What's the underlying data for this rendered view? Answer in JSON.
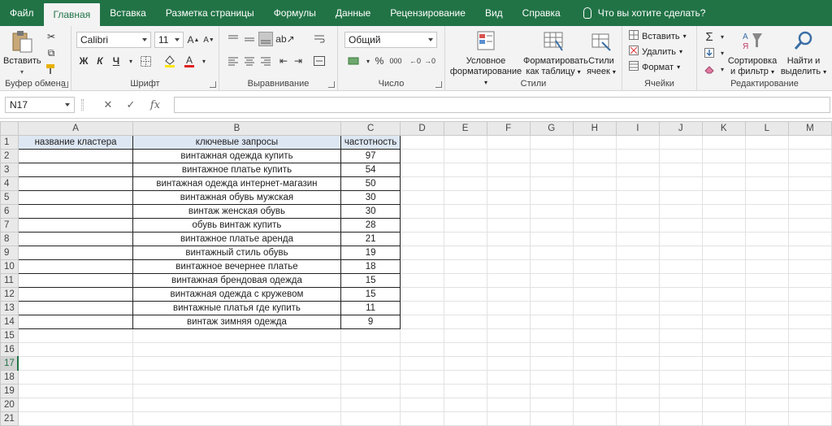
{
  "tabs": [
    "Файл",
    "Главная",
    "Вставка",
    "Разметка страницы",
    "Формулы",
    "Данные",
    "Рецензирование",
    "Вид",
    "Справка"
  ],
  "active_tab": 1,
  "tell_me": "Что вы хотите сделать?",
  "ribbon": {
    "clipboard": {
      "paste": "Вставить",
      "label": "Буфер обмена"
    },
    "font": {
      "name": "Calibri",
      "size": "11",
      "bold": "Ж",
      "italic": "К",
      "underline": "Ч",
      "grow": "A",
      "shrink": "A",
      "fontcolor": "A",
      "label": "Шрифт",
      "font_color": "#e02020",
      "highlight_color": "#ffe600"
    },
    "alignment": {
      "label": "Выравнивание"
    },
    "number": {
      "format": "Общий",
      "percent": "%",
      "thousands": "000",
      "label": "Число"
    },
    "styles": {
      "conditional": [
        "Условное",
        "форматирование"
      ],
      "as_table": [
        "Форматировать",
        "как таблицу"
      ],
      "cell_styles": [
        "Стили",
        "ячеек"
      ],
      "label": "Стили"
    },
    "cells": {
      "insert": "Вставить",
      "delete": "Удалить",
      "format": "Формат",
      "label": "Ячейки"
    },
    "editing": {
      "sort": [
        "Сортировка",
        "и фильтр"
      ],
      "find": [
        "Найти и",
        "выделить"
      ],
      "label": "Редактирование"
    }
  },
  "formula_bar": {
    "name_box": "N17",
    "fx": "fx",
    "value": ""
  },
  "columns": [
    "A",
    "B",
    "C",
    "D",
    "E",
    "F",
    "G",
    "H",
    "I",
    "J",
    "K",
    "L",
    "M"
  ],
  "selected_row": 17,
  "rows": [
    [
      "название кластера",
      "ключевые запросы",
      "частотность"
    ],
    [
      "",
      "винтажная одежда купить",
      "97"
    ],
    [
      "",
      "винтажное платье купить",
      "54"
    ],
    [
      "",
      "винтажная одежда интернет-магазин",
      "50"
    ],
    [
      "",
      "винтажная обувь мужская",
      "30"
    ],
    [
      "",
      "винтаж женская обувь",
      "30"
    ],
    [
      "",
      "обувь винтаж купить",
      "28"
    ],
    [
      "",
      "винтажное платье аренда",
      "21"
    ],
    [
      "",
      "винтажный стиль обувь",
      "19"
    ],
    [
      "",
      "винтажное вечернее платье",
      "18"
    ],
    [
      "",
      "винтажная брендовая одежда",
      "15"
    ],
    [
      "",
      "винтажная одежда с кружевом",
      "15"
    ],
    [
      "",
      "винтажные платья где купить",
      "11"
    ],
    [
      "",
      "винтаж зимняя одежда",
      "9"
    ]
  ],
  "total_rows": 21,
  "colors": {
    "excel_green": "#217346",
    "header_fill": "#dde7f3"
  }
}
